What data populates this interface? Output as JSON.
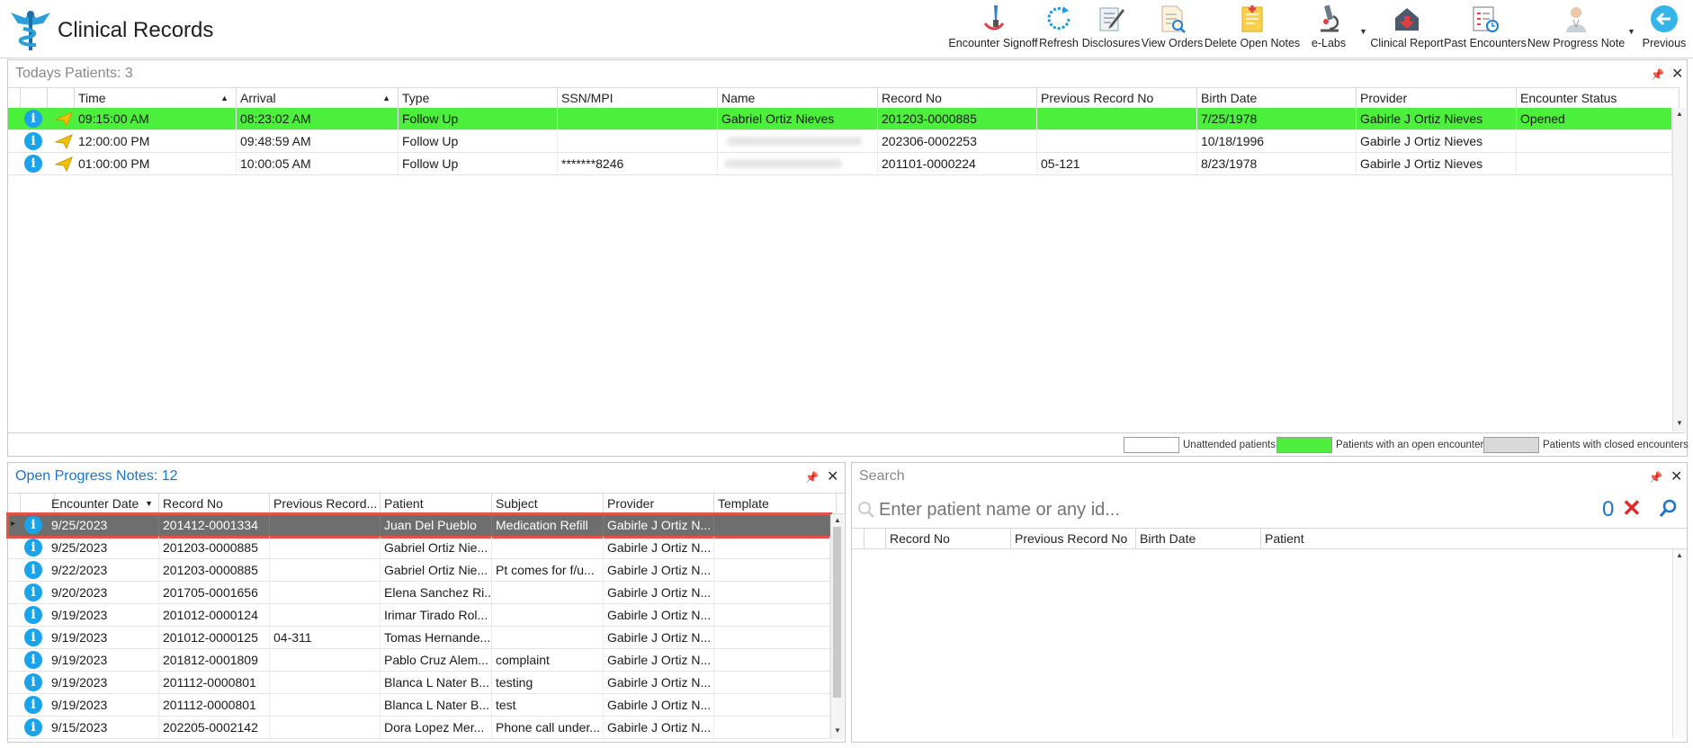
{
  "app": {
    "title": "Clinical Records"
  },
  "toolbar": [
    {
      "label": "Encounter Signoff",
      "icon": "signature-pen-icon"
    },
    {
      "label": "Refresh",
      "icon": "refresh-icon"
    },
    {
      "label": "Disclosures",
      "icon": "disclosure-edit-icon"
    },
    {
      "label": "View Orders",
      "icon": "view-orders-icon"
    },
    {
      "label": "Delete Open Notes",
      "icon": "delete-notes-icon"
    },
    {
      "label": "e-Labs",
      "icon": "microscope-icon"
    },
    {
      "label": "Clinical Report",
      "icon": "clinical-report-icon"
    },
    {
      "label": "Past Encounters",
      "icon": "past-encounters-icon"
    },
    {
      "label": "New Progress Note",
      "icon": "new-progress-note-icon"
    },
    {
      "label": "Previous",
      "icon": "back-arrow-icon"
    }
  ],
  "todays": {
    "title": "Todays Patients:",
    "count": "3",
    "columns": [
      "Time",
      "Arrival",
      "Type",
      "SSN/MPI",
      "Name",
      "Record No",
      "Previous Record No",
      "Birth Date",
      "Provider",
      "Encounter Status"
    ],
    "rows": [
      {
        "time": "09:15:00 AM",
        "arrival": "08:23:02 AM",
        "type": "Follow Up",
        "ssn": "",
        "name": "Gabriel Ortiz Nieves",
        "record": "201203-0000885",
        "prev": "",
        "birth": "7/25/1978",
        "provider": "Gabirle J Ortiz Nieves",
        "status": "Opened",
        "highlight": true
      },
      {
        "time": "12:00:00 PM",
        "arrival": "09:48:59 AM",
        "type": "Follow Up",
        "ssn": "",
        "name": "",
        "record": "202306-0002253",
        "prev": "",
        "birth": "10/18/1996",
        "provider": "Gabirle J Ortiz Nieves",
        "status": ""
      },
      {
        "time": "01:00:00 PM",
        "arrival": "10:00:05 AM",
        "type": "Follow Up",
        "ssn": "*******8246",
        "name": "",
        "record": "201101-0000224",
        "prev": "05-121",
        "birth": "8/23/1978",
        "provider": "Gabirle J Ortiz Nieves",
        "status": ""
      }
    ],
    "legend": [
      {
        "label": "Unattended patients",
        "color": "#ffffff"
      },
      {
        "label": "Patients with an open encounter",
        "color": "#4cf03c"
      },
      {
        "label": "Patients with closed encounters",
        "color": "#d9d9d9"
      }
    ]
  },
  "notes": {
    "title": "Open Progress Notes:",
    "count": "12",
    "columns": [
      "Encounter Date",
      "Record No",
      "Previous Record...",
      "Patient",
      "Subject",
      "Provider",
      "Template"
    ],
    "rows": [
      {
        "date": "9/25/2023",
        "record": "201412-0001334",
        "prev": "",
        "patient": "Juan Del Pueblo",
        "subject": "Medication Refill",
        "provider": "Gabirle J Ortiz N...",
        "template": "",
        "selected": true
      },
      {
        "date": "9/25/2023",
        "record": "201203-0000885",
        "prev": "",
        "patient": "Gabriel Ortiz Nie...",
        "subject": "",
        "provider": "Gabirle J Ortiz N...",
        "template": ""
      },
      {
        "date": "9/22/2023",
        "record": "201203-0000885",
        "prev": "",
        "patient": "Gabriel Ortiz Nie...",
        "subject": "Pt comes for f/u...",
        "provider": "Gabirle J Ortiz N...",
        "template": ""
      },
      {
        "date": "9/20/2023",
        "record": "201705-0001656",
        "prev": "",
        "patient": "Elena Sanchez Ri...",
        "subject": "",
        "provider": "Gabirle J Ortiz N...",
        "template": ""
      },
      {
        "date": "9/19/2023",
        "record": "201012-0000124",
        "prev": "",
        "patient": "Irimar Tirado Rol...",
        "subject": "",
        "provider": "Gabirle J Ortiz N...",
        "template": ""
      },
      {
        "date": "9/19/2023",
        "record": "201012-0000125",
        "prev": "04-311",
        "patient": "Tomas Hernande...",
        "subject": "",
        "provider": "Gabirle J Ortiz N...",
        "template": ""
      },
      {
        "date": "9/19/2023",
        "record": "201812-0001809",
        "prev": "",
        "patient": "Pablo Cruz Alem...",
        "subject": "complaint",
        "provider": "Gabirle J Ortiz N...",
        "template": ""
      },
      {
        "date": "9/19/2023",
        "record": "201112-0000801",
        "prev": "",
        "patient": "Blanca L Nater B...",
        "subject": "testing",
        "provider": "Gabirle J Ortiz N...",
        "template": ""
      },
      {
        "date": "9/19/2023",
        "record": "201112-0000801",
        "prev": "",
        "patient": "Blanca L Nater B...",
        "subject": "test",
        "provider": "Gabirle J Ortiz N...",
        "template": ""
      },
      {
        "date": "9/15/2023",
        "record": "202205-0002142",
        "prev": "",
        "patient": "Dora Lopez Mer...",
        "subject": "Phone call under...",
        "provider": "Gabirle J Ortiz N...",
        "template": ""
      }
    ]
  },
  "search": {
    "title": "Search",
    "placeholder": "Enter patient name or any id...",
    "result_count": "0",
    "columns": [
      "Record No",
      "Previous Record No",
      "Birth Date",
      "Patient"
    ]
  },
  "colors": {
    "open": "#4cf03c",
    "selected": "#6e6e6e",
    "accent": "#1e72c8",
    "info": "#1aa3e8"
  }
}
